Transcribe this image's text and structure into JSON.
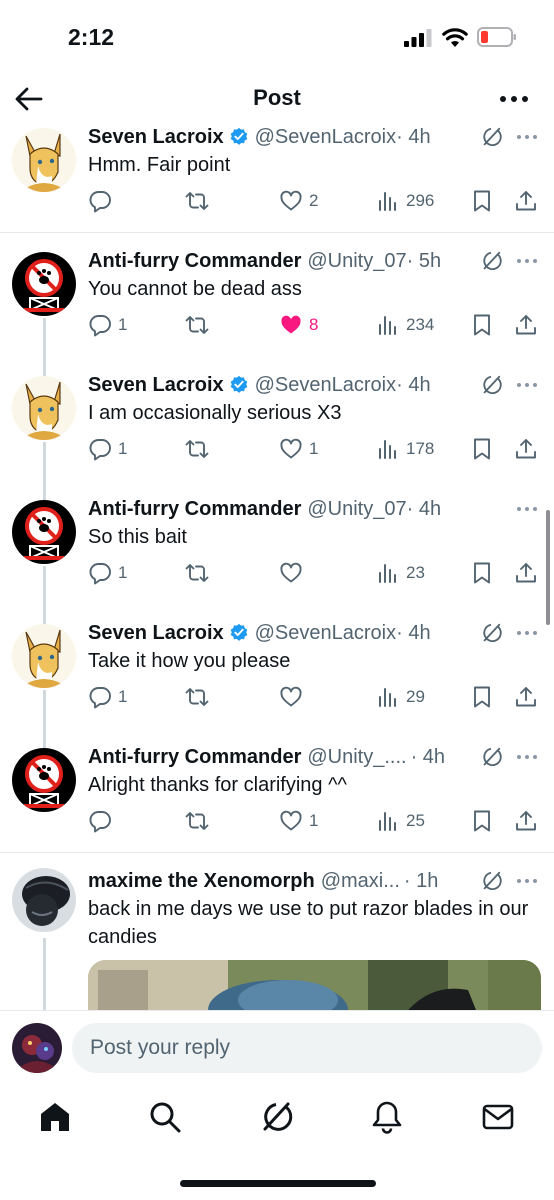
{
  "status_bar": {
    "time": "2:12"
  },
  "header": {
    "title": "Post"
  },
  "tweets": [
    {
      "name": "Seven Lacroix",
      "verified": true,
      "handle": "@SevenLacroix",
      "time": "· 4h",
      "text": "Hmm. Fair point",
      "replies": "",
      "retweets": "",
      "likes": "2",
      "views": "296",
      "liked": false
    },
    {
      "name": "Anti-furry Commander",
      "verified": false,
      "handle": "@Unity_07",
      "time": "· 5h",
      "text": "You cannot be dead ass",
      "replies": "1",
      "retweets": "",
      "likes": "8",
      "views": "234",
      "liked": true
    },
    {
      "name": "Seven Lacroix",
      "verified": true,
      "handle": "@SevenLacroix",
      "time": "· 4h",
      "text": "I am occasionally serious X3",
      "replies": "1",
      "retweets": "",
      "likes": "1",
      "views": "178",
      "liked": false
    },
    {
      "name": "Anti-furry Commander",
      "verified": false,
      "handle": "@Unity_07",
      "time": "· 4h",
      "text": "So this bait",
      "replies": "1",
      "retweets": "",
      "likes": "",
      "views": "23",
      "liked": false
    },
    {
      "name": "Seven Lacroix",
      "verified": true,
      "handle": "@SevenLacroix",
      "time": "· 4h",
      "text": "Take it how you please",
      "replies": "1",
      "retweets": "",
      "likes": "",
      "views": "29",
      "liked": false
    },
    {
      "name": "Anti-furry Commander",
      "verified": false,
      "handle": "@Unity_....",
      "time": "· 4h",
      "text": "Alright thanks for clarifying ^^",
      "replies": "",
      "retweets": "",
      "likes": "1",
      "views": "25",
      "liked": false
    },
    {
      "name": "maxime the Xenomorph",
      "verified": false,
      "handle": "@maxi...",
      "time": "· 1h",
      "text": "back in me days we use to put razor blades in our candies",
      "replies": "",
      "retweets": "",
      "likes": "",
      "views": "",
      "liked": false
    }
  ],
  "reply": {
    "placeholder": "Post your reply"
  },
  "colors": {
    "accent": "#1d9bf0",
    "like": "#f91880",
    "muted": "#536471",
    "text": "#0f1419"
  }
}
